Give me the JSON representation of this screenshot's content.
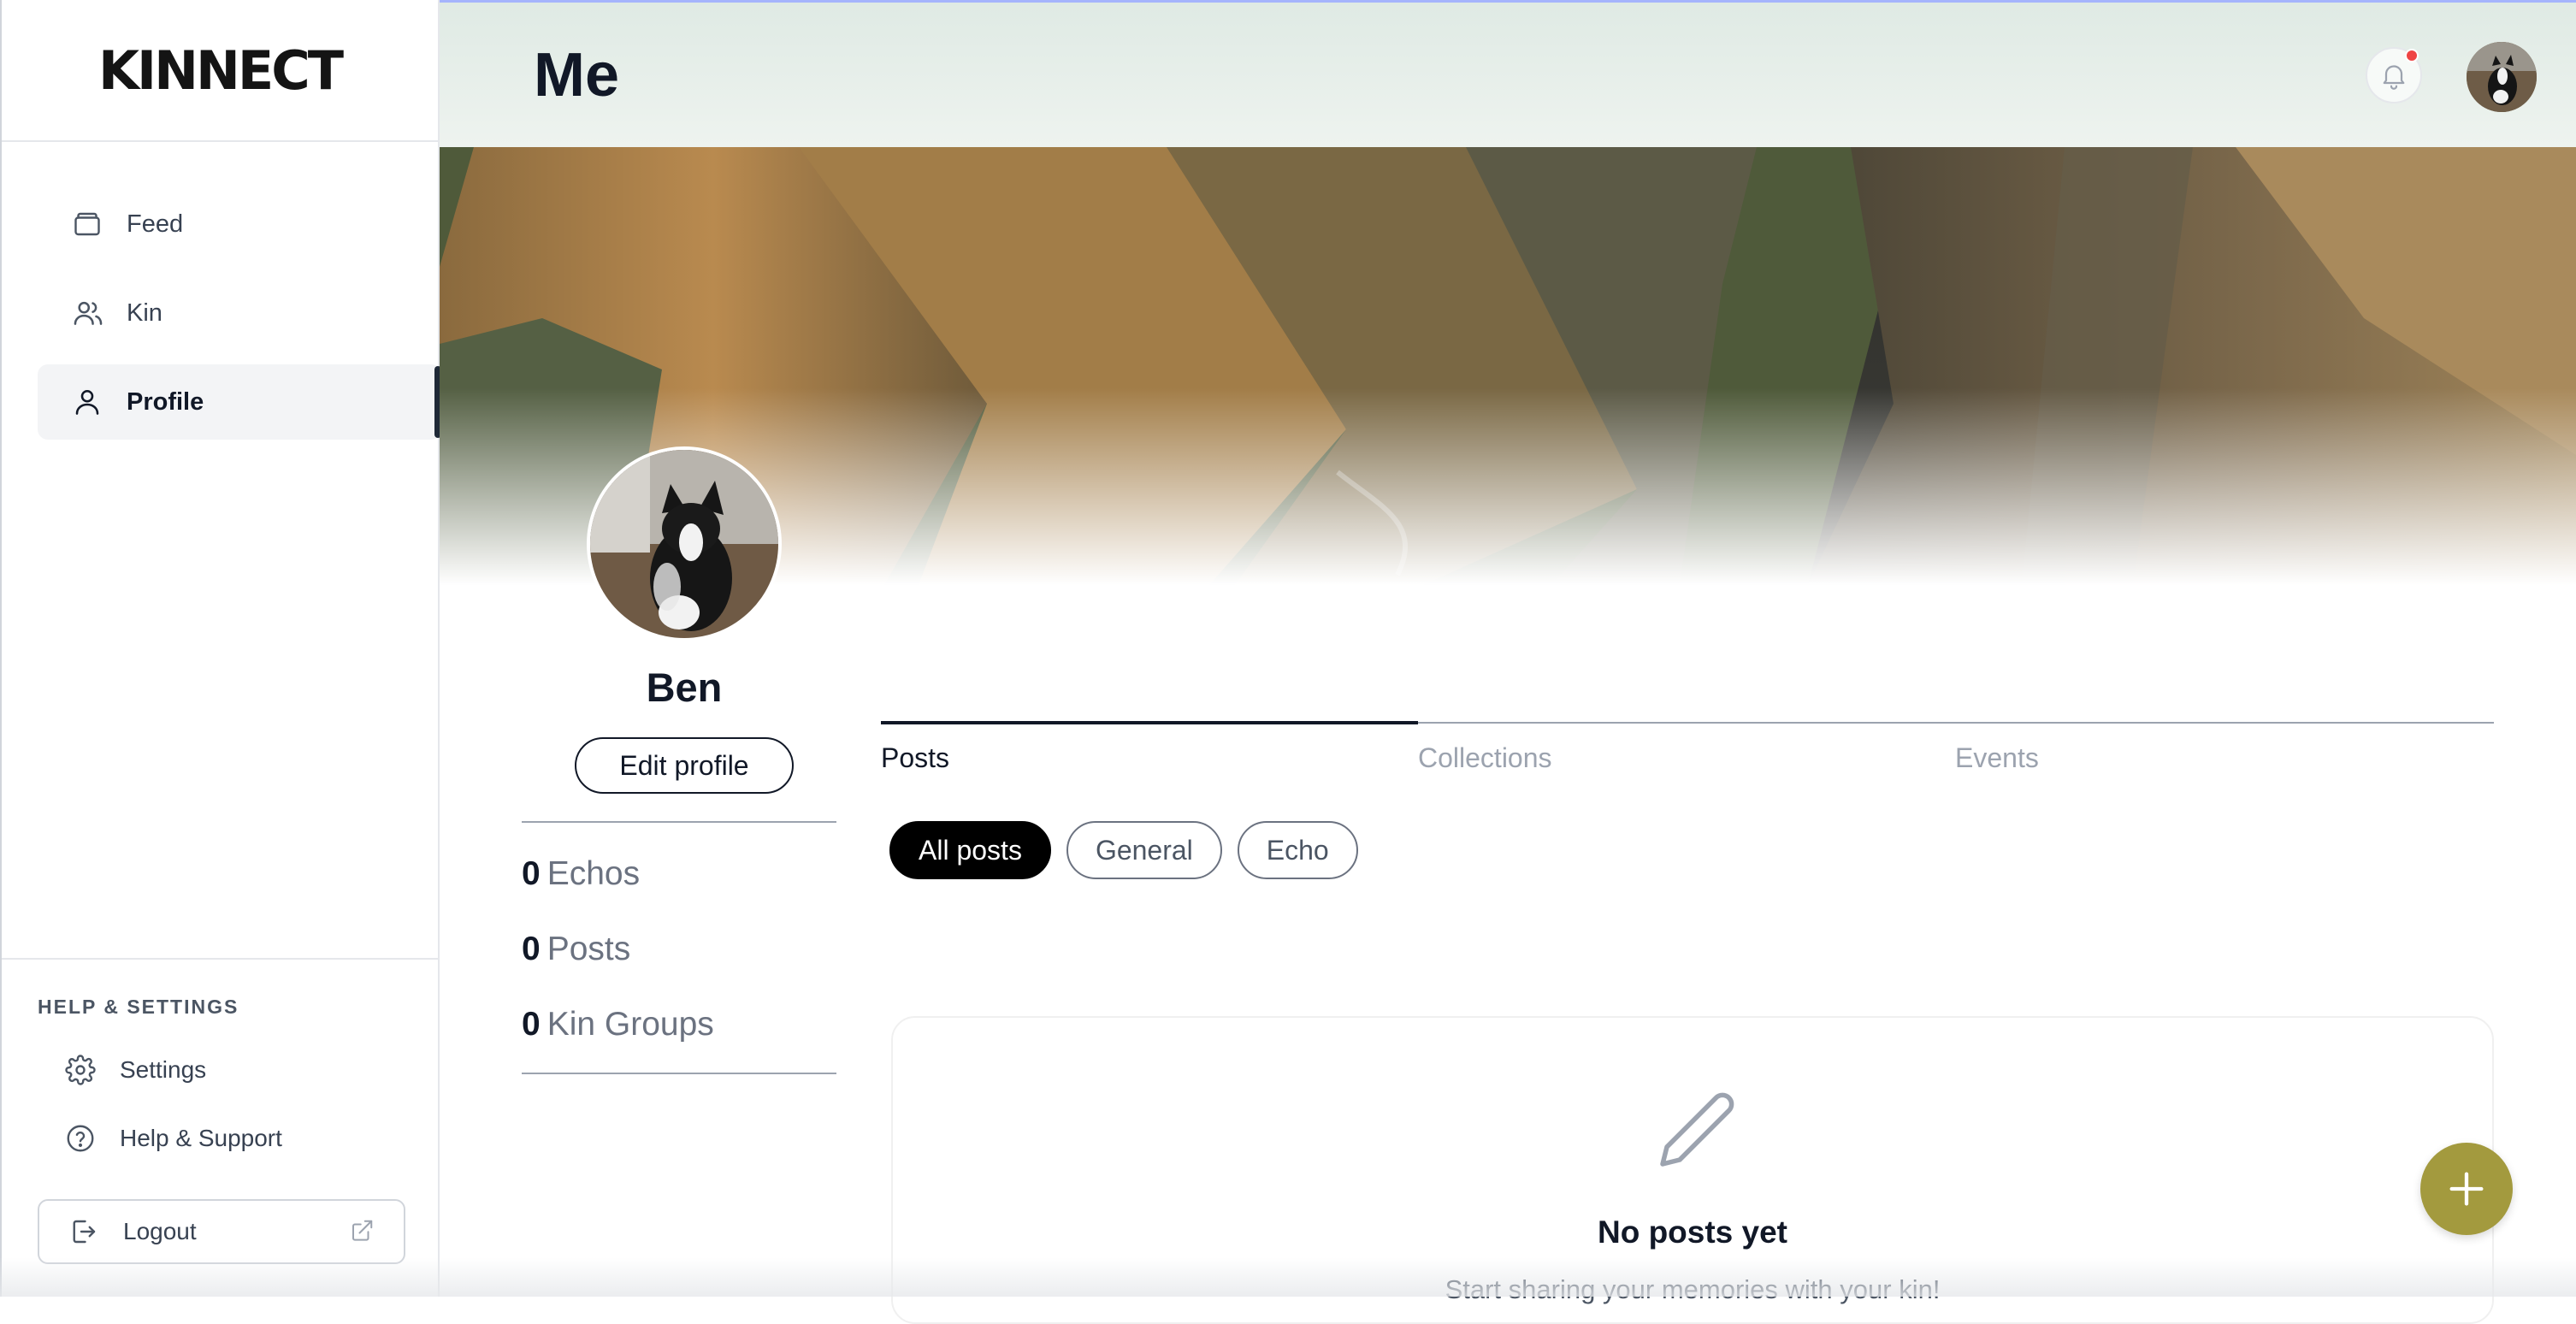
{
  "app": {
    "logo": "KINNECT"
  },
  "sidebar": {
    "items": [
      {
        "label": "Feed",
        "icon": "layers-icon"
      },
      {
        "label": "Kin",
        "icon": "users-icon"
      },
      {
        "label": "Profile",
        "icon": "user-icon",
        "active": true
      }
    ],
    "help": {
      "title": "HELP & SETTINGS",
      "items": [
        {
          "label": "Settings",
          "icon": "gear-icon"
        },
        {
          "label": "Help & Support",
          "icon": "help-circle-icon"
        }
      ]
    },
    "logout_label": "Logout"
  },
  "header": {
    "title": "Me",
    "notification_dot_color": "#ef4444"
  },
  "profile": {
    "name": "Ben",
    "edit_label": "Edit profile",
    "stats": [
      {
        "value": "0",
        "label": "Echos"
      },
      {
        "value": "0",
        "label": "Posts"
      },
      {
        "value": "0",
        "label": "Kin Groups"
      }
    ]
  },
  "tabs": [
    {
      "label": "Posts",
      "active": true
    },
    {
      "label": "Collections"
    },
    {
      "label": "Events"
    }
  ],
  "filters": [
    {
      "label": "All posts",
      "active": true
    },
    {
      "label": "General"
    },
    {
      "label": "Echo"
    }
  ],
  "empty": {
    "title": "No posts yet",
    "subtitle": "Start sharing your memories with your kin!"
  },
  "colors": {
    "fab": "#a39a3e",
    "accent_text": "#111827"
  }
}
